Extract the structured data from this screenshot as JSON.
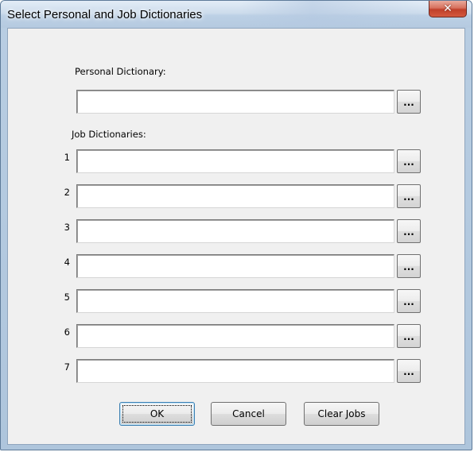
{
  "window": {
    "title": "Select Personal and Job Dictionaries",
    "close_glyph": "✕"
  },
  "personal": {
    "label": "Personal Dictionary:",
    "value": "",
    "browse_label": "..."
  },
  "jobs": {
    "label": "Job Dictionaries:",
    "rows": [
      {
        "num": "1",
        "value": "",
        "browse_label": "..."
      },
      {
        "num": "2",
        "value": "",
        "browse_label": "..."
      },
      {
        "num": "3",
        "value": "",
        "browse_label": "..."
      },
      {
        "num": "4",
        "value": "",
        "browse_label": "..."
      },
      {
        "num": "5",
        "value": "",
        "browse_label": "..."
      },
      {
        "num": "6",
        "value": "",
        "browse_label": "..."
      },
      {
        "num": "7",
        "value": "",
        "browse_label": "..."
      }
    ]
  },
  "buttons": {
    "ok": "OK",
    "cancel": "Cancel",
    "clear_jobs": "Clear Jobs"
  }
}
